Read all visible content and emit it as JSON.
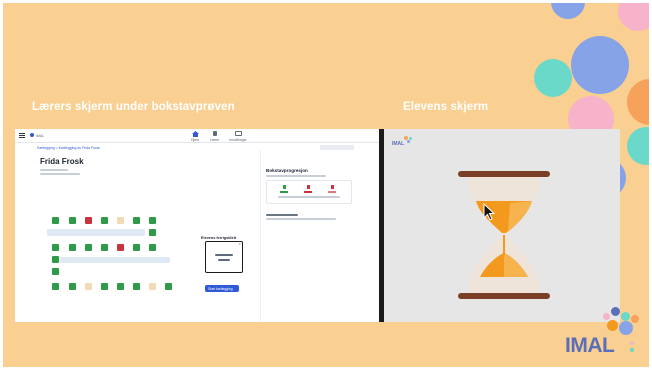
{
  "slide": {
    "teacher_title": "Lærers skjerm under bokstavprøven",
    "student_title": "Elevens skjerm",
    "logo_text": "IMAL"
  },
  "teacher_app": {
    "breadcrumb": "Kartlegging > Kartlegging av Frida Frosk",
    "student_name": "Frida Frosk",
    "nav": [
      "Hjem",
      "Lærer",
      "Innstillinger"
    ],
    "panel_title": "Bokstavprogresjon",
    "modal_title": "Elevens ferrigstilelt",
    "start_button": "Start kartlegging"
  },
  "colors": {
    "background": "#f9cf92",
    "accent_blue": "#2f59d6",
    "correct_green": "#2e9b49",
    "wrong_red": "#c9343c",
    "hourglass_orange": "#f39a1e"
  },
  "icons": [
    "hamburger-icon",
    "home-icon",
    "cursor-arrow-icon",
    "hourglass-icon",
    "close-icon"
  ]
}
